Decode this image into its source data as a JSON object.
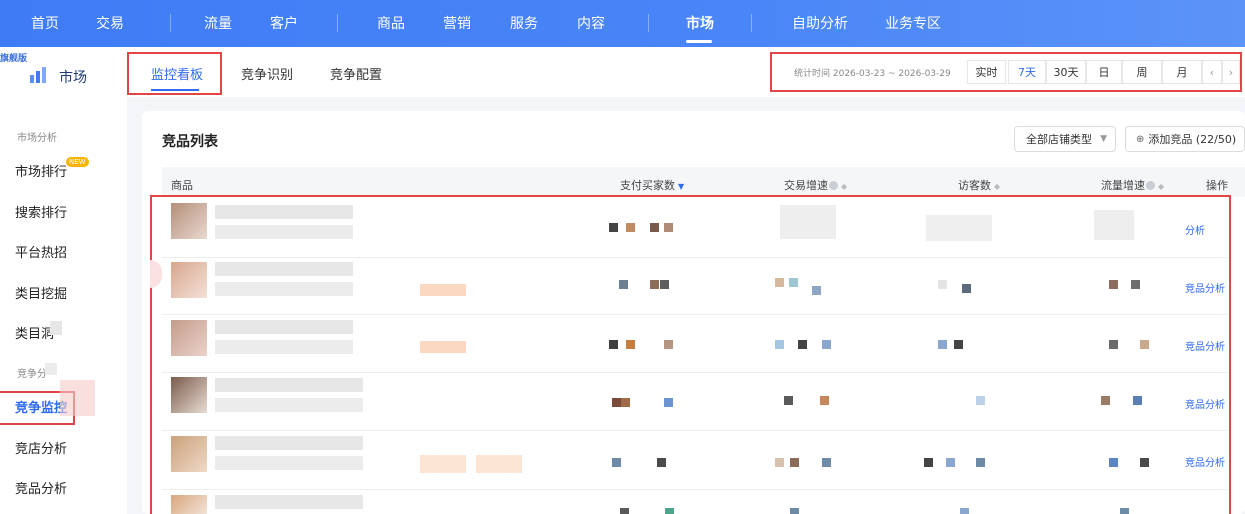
{
  "topnav": {
    "items": [
      "首页",
      "交易",
      "流量",
      "客户",
      "商品",
      "营销",
      "服务",
      "内容",
      "市场",
      "自助分析",
      "业务专区"
    ],
    "active": "市场"
  },
  "sidebar": {
    "badge": "旗舰版",
    "title": "市场",
    "sections": [
      {
        "label": "市场分析",
        "items": [
          "市场排行",
          "搜索排行",
          "平台热招",
          "类目挖掘",
          "类目洞"
        ]
      },
      {
        "label": "竞争分",
        "items": [
          "竞争监控",
          "竞店分析",
          "竞品分析"
        ]
      }
    ],
    "new_badge": "NEW",
    "active_item": "竞争监控"
  },
  "tabs": {
    "items": [
      "监控看板",
      "竞争识别",
      "竞争配置"
    ],
    "active": "监控看板"
  },
  "time_range": {
    "label": "统计时间 2026-03-23 ~ 2026-03-29",
    "options": [
      "实时",
      "7天",
      "30天",
      "日",
      "周",
      "月"
    ],
    "active": "7天",
    "prev": "‹",
    "next": "›"
  },
  "card": {
    "title": "竞品列表",
    "shop_type_select": "全部店铺类型",
    "add_button": "添加竞品 (22/50)"
  },
  "table": {
    "columns": [
      "商品",
      "支付买家数",
      "交易增速",
      "访客数",
      "流量增速",
      "操作"
    ],
    "row_action": "竞品分析",
    "row_count": 6
  },
  "colors": {
    "brand": "#3f7bf5",
    "link": "#2f6bf0",
    "highlight_box": "#e24545"
  }
}
